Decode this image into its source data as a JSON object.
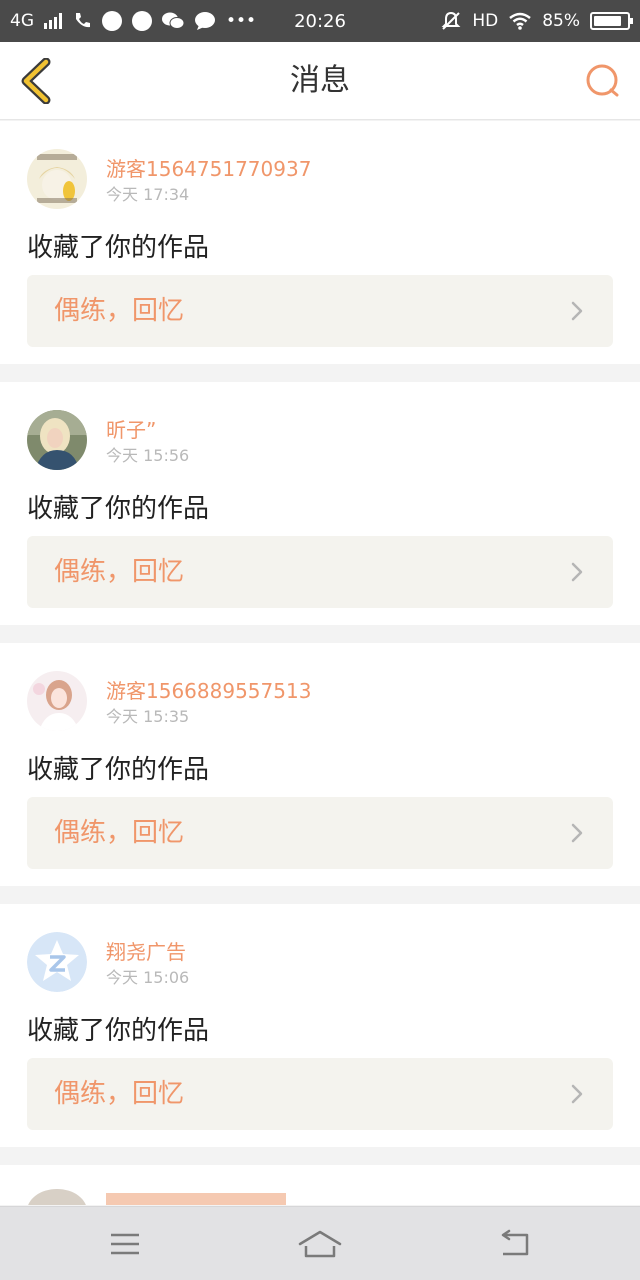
{
  "statusbar": {
    "network": "4G",
    "time": "20:26",
    "hd": "HD",
    "battery_pct": "85%",
    "battery_level": 0.85
  },
  "nav": {
    "title": "消息"
  },
  "messages": [
    {
      "username": "游客1564751770937",
      "time": "今天 17:34",
      "action": "收藏了你的作品",
      "work_title": "偶练，回忆"
    },
    {
      "username": "昕子”",
      "time": "今天 15:56",
      "action": "收藏了你的作品",
      "work_title": "偶练，回忆"
    },
    {
      "username": "游客1566889557513",
      "time": "今天 15:35",
      "action": "收藏了你的作品",
      "work_title": "偶练，回忆"
    },
    {
      "username": "翔尧广告",
      "time": "今天 15:06",
      "action": "收藏了你的作品",
      "work_title": "偶练，回忆"
    }
  ],
  "colors": {
    "accent": "#f0966a",
    "back_icon": "#f1c232",
    "work_box_bg": "#f4f3ee"
  },
  "icons": {
    "back": "chevron-left-icon",
    "search": "search-icon",
    "work": "chevron-right-icon",
    "menu": "menu-icon",
    "home": "home-icon",
    "return": "back-icon"
  }
}
